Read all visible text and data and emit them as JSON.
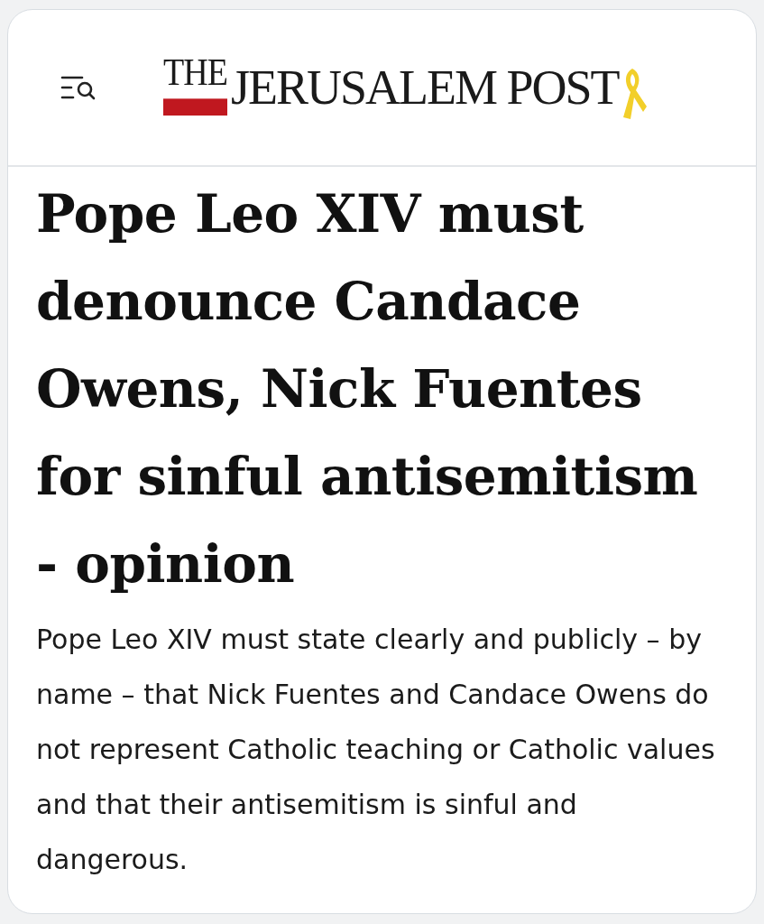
{
  "header": {
    "logo": {
      "prefix": "THE",
      "name": "JERUSALEM POST"
    }
  },
  "article": {
    "headline": "Pope Leo XIV must denounce Candace Owens, Nick Fuentes for sinful antisemitism - opinion",
    "summary": "Pope Leo XIV must state clearly and publicly – by name – that Nick Fuentes and Candace Owens do not represent Catholic teaching or Catholic values and that their antisemitism is sinful and dangerous."
  }
}
